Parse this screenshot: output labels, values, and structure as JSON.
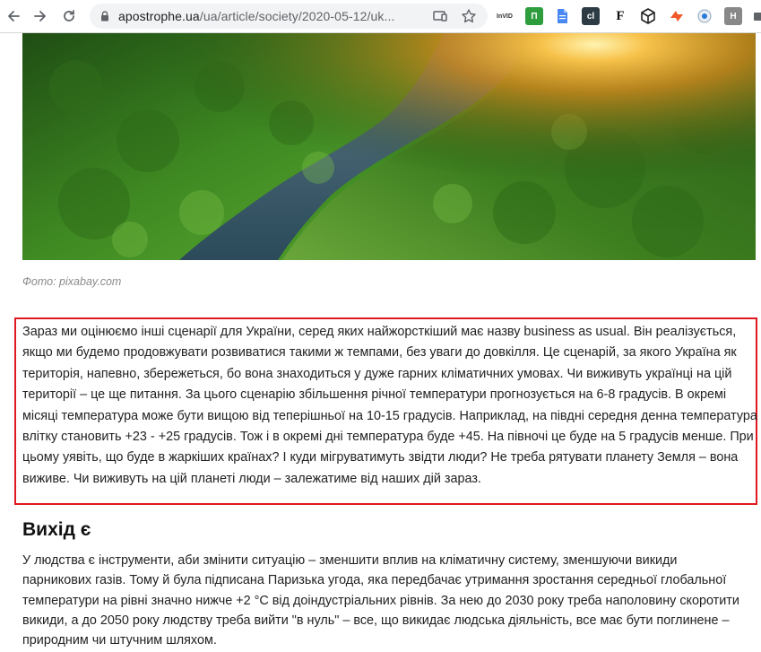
{
  "browser": {
    "url_host": "apostrophe.ua",
    "url_path": "/ua/article/society/2020-05-12/uk...",
    "extensions": [
      {
        "name": "inVID",
        "label": "InVID"
      },
      {
        "name": "privatbank",
        "label": "П"
      },
      {
        "name": "docs",
        "label": ""
      },
      {
        "name": "cl",
        "label": "cl"
      },
      {
        "name": "f",
        "label": "F"
      },
      {
        "name": "cube",
        "label": ""
      },
      {
        "name": "arrow",
        "label": ""
      },
      {
        "name": "circle",
        "label": ""
      },
      {
        "name": "h",
        "label": "H"
      },
      {
        "name": "puzzle",
        "label": ""
      }
    ]
  },
  "article": {
    "photo_caption": "Фото: pixabay.com",
    "highlighted_paragraph": "Зараз ми оцінюємо інші сценарії для України, серед яких найжорсткіший має назву business as usual. Він реалізується, якщо ми будемо продовжувати розвиватися такими ж темпами, без уваги до довкілля. Це сценарій, за якого Україна як територія, напевно, збережеться, бо вона знаходиться у дуже гарних кліматичних умовах. Чи виживуть українці на цій території – це ще питання. За цього сценарію збільшення річної температури прогнозується на 6-8 градусів. В окремі місяці температура може бути вищою від теперішньої на 10-15 градусів. Наприклад, на півдні середня денна температура влітку становить +23 - +25 градусів. Тож і в окремі дні температура буде +45. На півночі це буде на 5 градусів менше. При цьому уявіть, що буде в жаркіших країнах? І куди мігруватимуть звідти люди? Не треба рятувати планету Земля – вона виживе. Чи виживуть на цій планеті люди – залежатиме від наших дій зараз.",
    "section_heading": "Вихід є",
    "section_paragraph": "У людства є інструменти, аби змінити ситуацію – зменшити вплив на кліматичну систему, зменшуючи викиди парникових газів. Тому й була підписана Паризька угода, яка передбачає утримання зростання середньої глобальної температури на рівні значно нижче +2 °C від доіндустріальних рівнів. За нею до 2030 року треба наполовину скоротити викиди, а до 2050 року людству треба вийти \"в нуль\" – все, що викидає людська діяльність, все має бути поглинене – природним чи штучним шляхом.",
    "highlight_color": "#e0181f"
  }
}
